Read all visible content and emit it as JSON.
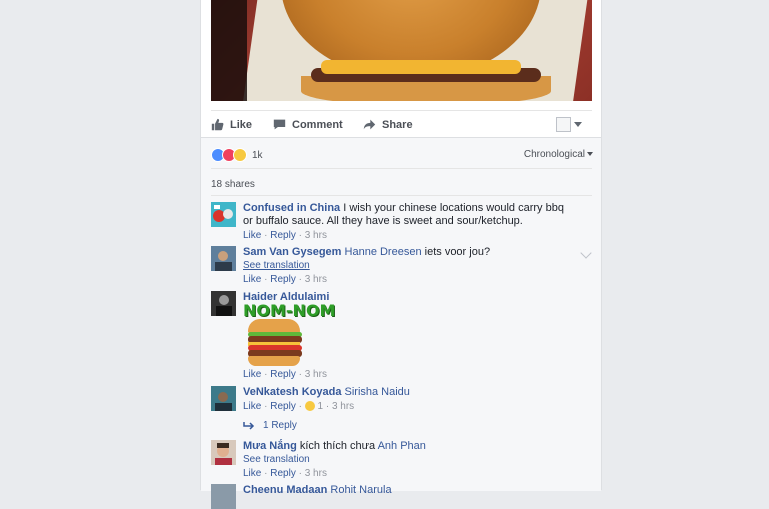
{
  "post": {
    "actions": {
      "like": "Like",
      "comment": "Comment",
      "share": "Share"
    }
  },
  "summary": {
    "reaction_count": "1k",
    "order": "Chronological",
    "shares": "18 shares"
  },
  "comments": [
    {
      "author": "Confused in China",
      "text": "I wish your chinese locations would carry bbq or buffalo sauce. All they have is sweet and sour/ketchup.",
      "like": "Like",
      "reply": "Reply",
      "time": "3 hrs"
    },
    {
      "author": "Sam Van Gysegem",
      "mention": "Hanne Dreesen",
      "text": "iets voor jou?",
      "see_translation": "See translation",
      "like": "Like",
      "reply": "Reply",
      "time": "3 hrs"
    },
    {
      "author": "Haider Aldulaimi",
      "sticker_text": "NOM-NOM",
      "like": "Like",
      "reply": "Reply",
      "time": "3 hrs"
    },
    {
      "author": "VeNkatesh Koyada",
      "mention": "Sirisha Naidu",
      "like": "Like",
      "reply": "Reply",
      "reaction_count": "1",
      "time": "3 hrs",
      "replies_label": "1 Reply"
    },
    {
      "author": "Mưa Nắng",
      "text": "kích thích chưa",
      "mention": "Anh Phan",
      "see_translation": "See translation",
      "like": "Like",
      "reply": "Reply",
      "time": "3 hrs"
    },
    {
      "author": "Cheenu Madaan",
      "mention": "Rohit Narula"
    }
  ],
  "colors": {
    "link": "#365899",
    "meta": "#90949c",
    "background": "#e9ebee"
  }
}
